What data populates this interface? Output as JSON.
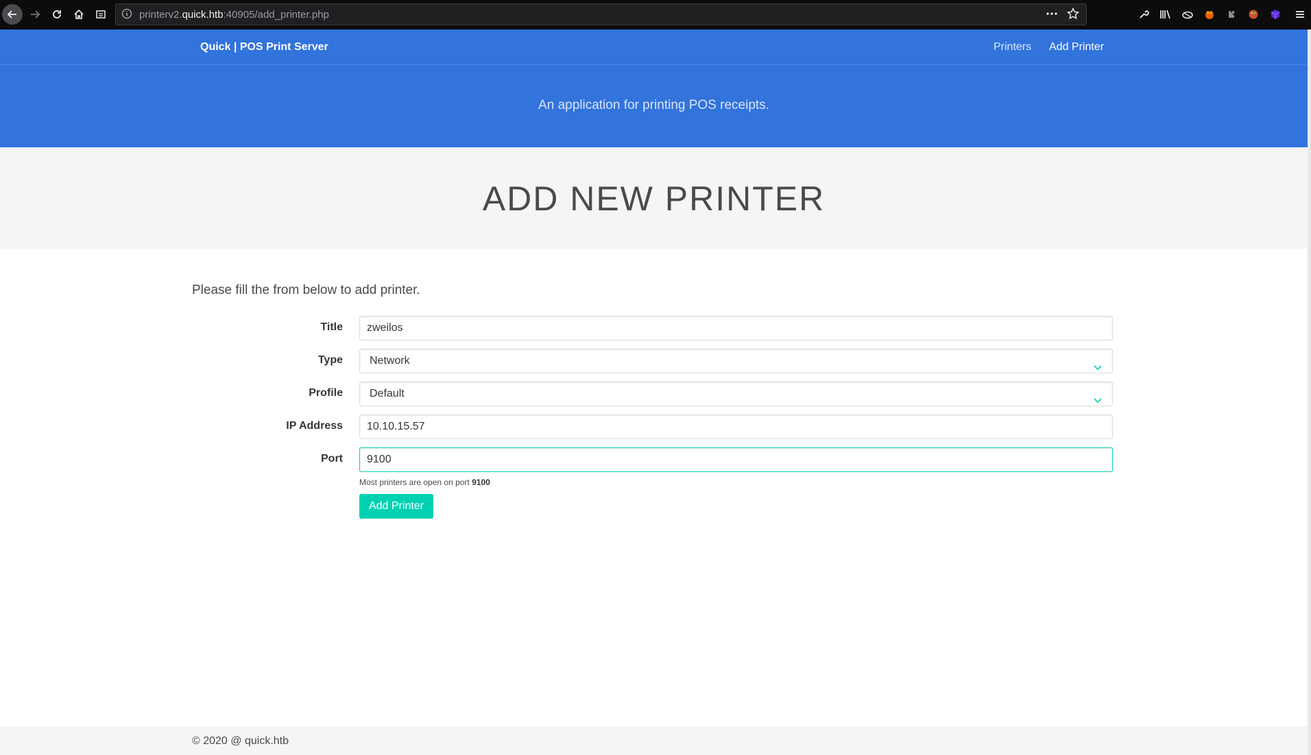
{
  "browser": {
    "url_prefix": "printerv2.",
    "url_host": "quick.htb",
    "url_suffix": ":40905/add_printer.php"
  },
  "nav": {
    "brand": "Quick | POS Print Server",
    "links": [
      "Printers",
      "Add Printer"
    ]
  },
  "hero": {
    "subtitle": "An application for printing POS receipts."
  },
  "header": {
    "title": "ADD NEW PRINTER"
  },
  "form": {
    "intro": "Please fill the from below to add printer.",
    "title_label": "Title",
    "title_value": "zweilos",
    "type_label": "Type",
    "type_value": "Network",
    "profile_label": "Profile",
    "profile_value": "Default",
    "ip_label": "IP Address",
    "ip_value": "10.10.15.57",
    "port_label": "Port",
    "port_value": "9100",
    "help_text": "Most printers are open on port",
    "help_port": "9100",
    "submit_label": "Add Printer"
  },
  "footer": {
    "copyright": "© 2020 @ quick.htb"
  },
  "colors": {
    "primary": "#3273dc",
    "accent": "#00d1b2"
  }
}
